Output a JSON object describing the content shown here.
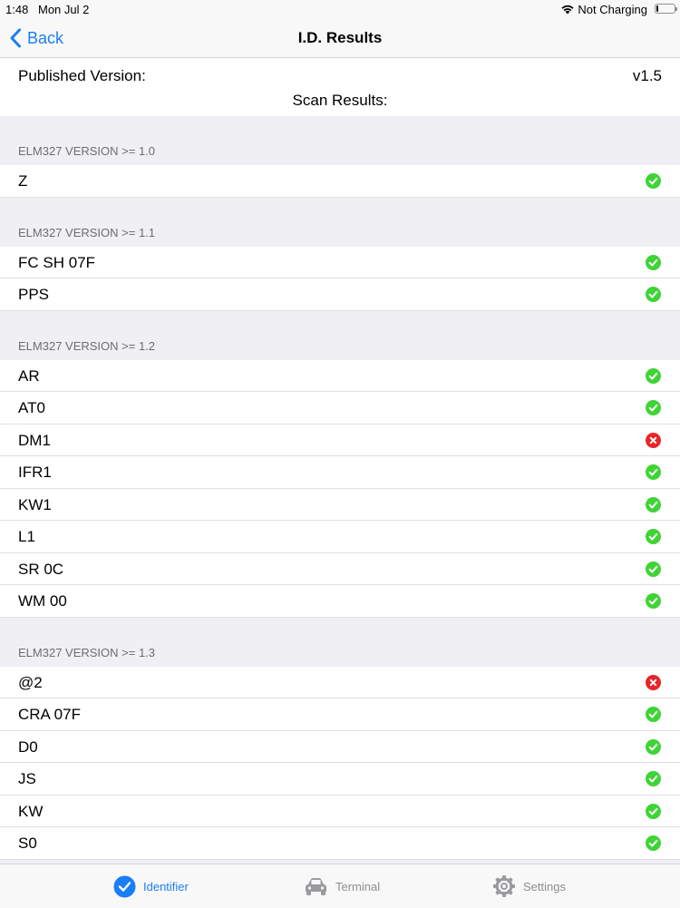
{
  "status_bar": {
    "time": "1:48",
    "date": "Mon Jul 2",
    "charging": "Not Charging"
  },
  "nav": {
    "back_label": "Back",
    "title": "I.D. Results"
  },
  "summary": {
    "published_label": "Published Version:",
    "published_value": "v1.5",
    "scan_label": "Scan Results:"
  },
  "colors": {
    "accent": "#1a7ef7",
    "ok": "#3fd436",
    "fail": "#e8262a"
  },
  "sections": [
    {
      "header": "ELM327 VERSION >= 1.0",
      "items": [
        {
          "label": "Z",
          "status": "ok"
        }
      ]
    },
    {
      "header": "ELM327 VERSION >= 1.1",
      "items": [
        {
          "label": "FC SH 07F",
          "status": "ok"
        },
        {
          "label": "PPS",
          "status": "ok"
        }
      ]
    },
    {
      "header": "ELM327 VERSION >= 1.2",
      "items": [
        {
          "label": "AR",
          "status": "ok"
        },
        {
          "label": "AT0",
          "status": "ok"
        },
        {
          "label": "DM1",
          "status": "fail"
        },
        {
          "label": "IFR1",
          "status": "ok"
        },
        {
          "label": "KW1",
          "status": "ok"
        },
        {
          "label": "L1",
          "status": "ok"
        },
        {
          "label": "SR 0C",
          "status": "ok"
        },
        {
          "label": "WM 00",
          "status": "ok"
        }
      ]
    },
    {
      "header": "ELM327 VERSION >= 1.3",
      "items": [
        {
          "label": "@2",
          "status": "fail"
        },
        {
          "label": "CRA 07F",
          "status": "ok"
        },
        {
          "label": "D0",
          "status": "ok"
        },
        {
          "label": "JS",
          "status": "ok"
        },
        {
          "label": "KW",
          "status": "ok"
        },
        {
          "label": "S0",
          "status": "ok"
        }
      ]
    }
  ],
  "tabs": [
    {
      "label": "Identifier",
      "icon": "checkmark-circle-icon",
      "active": true
    },
    {
      "label": "Terminal",
      "icon": "car-icon",
      "active": false
    },
    {
      "label": "Settings",
      "icon": "gear-icon",
      "active": false
    }
  ]
}
